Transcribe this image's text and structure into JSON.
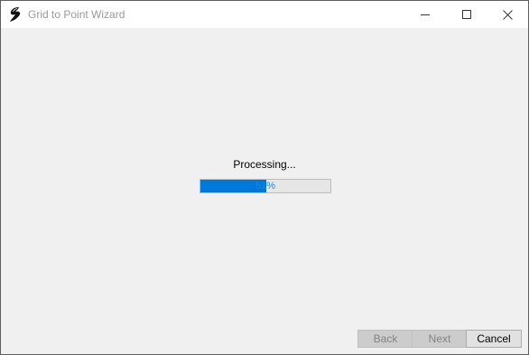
{
  "window": {
    "title": "Grid to Point Wizard",
    "icon": "app-logo-icon",
    "controls": {
      "minimize_icon": "minimize-icon",
      "maximize_icon": "maximize-icon",
      "close_icon": "close-icon"
    }
  },
  "main": {
    "status_text": "Processing...",
    "progress": {
      "percent": 51,
      "label": "51%"
    }
  },
  "footer": {
    "back_label": "Back",
    "next_label": "Next",
    "cancel_label": "Cancel"
  },
  "colors": {
    "progress_fill": "#0078d7",
    "window_bg": "#f0f0f0",
    "titlebar_bg": "#ffffff"
  }
}
